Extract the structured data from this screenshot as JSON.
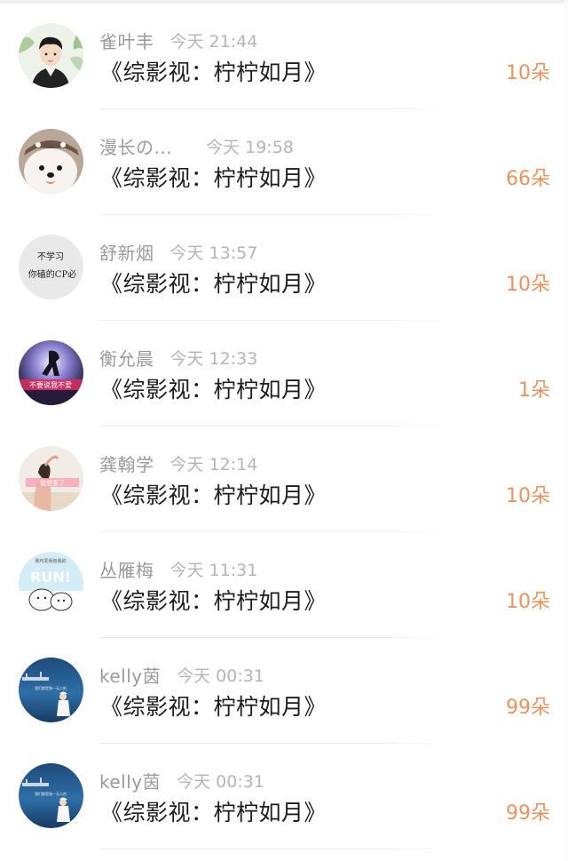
{
  "rows": [
    {
      "name": "雀叶丰",
      "time": "今天 21:44",
      "book": "《综影视：柠柠如月》",
      "gift": "10朵",
      "avatar": "boy-portrait"
    },
    {
      "name": "漫长の...",
      "time": "今天 19:58",
      "book": "《综影视：柠柠如月》",
      "gift": "66朵",
      "avatar": "samoyed-dog"
    },
    {
      "name": "舒新烟",
      "time": "今天 13:57",
      "book": "《综影视：柠柠如月》",
      "gift": "10朵",
      "avatar": "text-image"
    },
    {
      "name": "衡允晨",
      "time": "今天 12:33",
      "book": "《综影视：柠柠如月》",
      "gift": "1朵",
      "avatar": "night-silhouette"
    },
    {
      "name": "龚翰学",
      "time": "今天 12:14",
      "book": "《综影视：柠柠如月》",
      "gift": "10朵",
      "avatar": "girl-beach"
    },
    {
      "name": "丛雁梅",
      "time": "今天 11:31",
      "book": "《综影视：柠柠如月》",
      "gift": "10朵",
      "avatar": "cartoon-bear"
    },
    {
      "name": "kelly茵",
      "time": "今天 00:31",
      "book": "《综影视：柠柠如月》",
      "gift": "99朵",
      "avatar": "ocean-girl"
    },
    {
      "name": "kelly茵",
      "time": "今天 00:31",
      "book": "《综影视：柠柠如月》",
      "gift": "99朵",
      "avatar": "ocean-girl"
    }
  ],
  "avatar_text": {
    "row3_line1": "不学习",
    "row3_line2": "你磕的CP必",
    "row4_banner": "不要说我不爱",
    "row5_banner": "我想多了",
    "row6_banner": "RUN!",
    "row6_caption": "我可爱我有我的",
    "row7_caption": "我们都是独一无二的",
    "row8_caption": "我们都是独一无二的"
  },
  "colors": {
    "name": "#9a9a9a",
    "time": "#b5b5b5",
    "book": "#1d1d1d",
    "gift": "#e7935f",
    "divider": "#efefef"
  }
}
